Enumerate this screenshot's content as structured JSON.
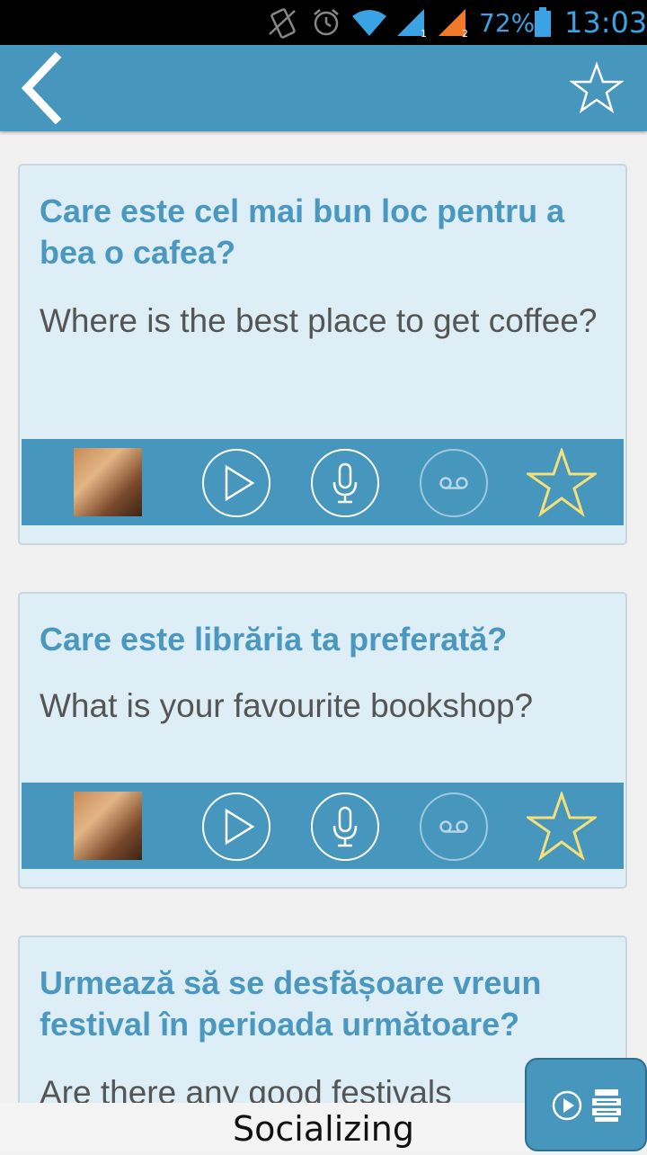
{
  "status_bar": {
    "battery_percent": "72%",
    "time": "13:03"
  },
  "app_bar": {
    "back_icon": "chevron-left-icon",
    "favorite_icon": "star-outline-icon"
  },
  "phrases": [
    {
      "romanian": "Care este cel mai bun loc pentru a bea o cafea?",
      "english": "Where is the best place to get coffee?",
      "favorited": true
    },
    {
      "romanian": "Care este librăria ta preferată?",
      "english": "What is your favourite bookshop?",
      "favorited": true
    },
    {
      "romanian": "Urmează să se desfășoare vreun festival în perioada următoare?",
      "english": "Are there any good festivals"
    }
  ],
  "toolbar_icons": [
    "avatar",
    "play-icon",
    "microphone-icon",
    "voicemail-icon",
    "star-icon"
  ],
  "bottom_bar": {
    "title": "Socializing"
  },
  "colors": {
    "accent": "#4796bd",
    "card": "#ddeef6",
    "romanian_text": "#4a97c0",
    "star": "#f3e07a"
  }
}
